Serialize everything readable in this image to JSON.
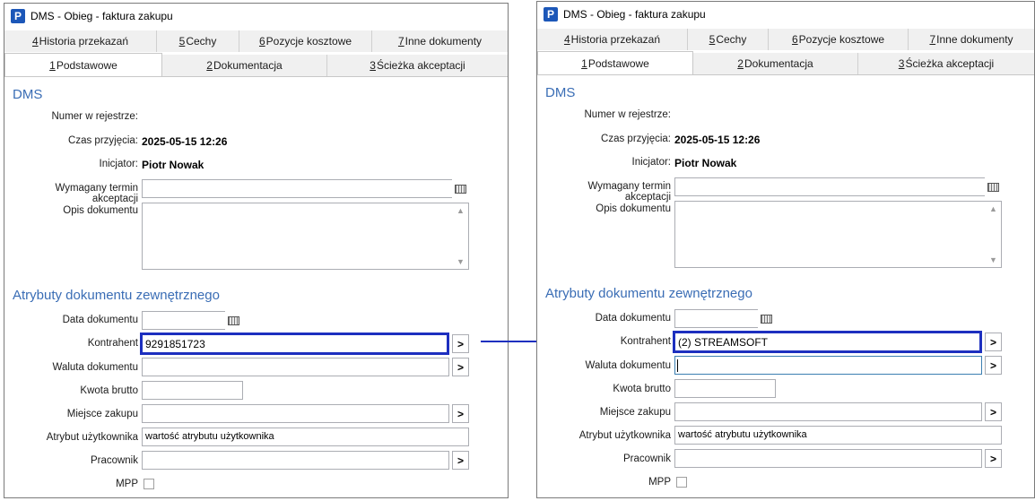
{
  "windows": [
    {
      "title": "DMS - Obieg - faktura zakupu",
      "tabs_row1": [
        {
          "num": "4",
          "label": "Historia przekazań"
        },
        {
          "num": "5",
          "label": "Cechy"
        },
        {
          "num": "6",
          "label": "Pozycje kosztowe"
        },
        {
          "num": "7",
          "label": "Inne dokumenty"
        }
      ],
      "tabs_row2": [
        {
          "num": "1",
          "label": "Podstawowe"
        },
        {
          "num": "2",
          "label": "Dokumentacja"
        },
        {
          "num": "3",
          "label": "Ścieżka akceptacji"
        }
      ],
      "section_dms": "DMS",
      "numer_label": "Numer w rejestrze:",
      "czas_label": "Czas przyjęcia:",
      "czas_value": "2025-05-15 12:26",
      "inicjator_label": "Inicjator:",
      "inicjator_value": "Piotr Nowak",
      "termin_label": "Wymagany termin akceptacji",
      "opis_label": "Opis dokumentu",
      "section_attr": "Atrybuty dokumentu zewnętrznego",
      "data_label": "Data dokumentu",
      "kontrahent_label": "Kontrahent",
      "kontrahent_value": "9291851723",
      "waluta_label": "Waluta dokumentu",
      "kwota_label": "Kwota brutto",
      "miejsce_label": "Miejsce zakupu",
      "atrybut_label": "Atrybut użytkownika",
      "atrybut_value": "wartość atrybutu użytkownika",
      "pracownik_label": "Pracownik",
      "mpp_label": "MPP",
      "arrow_btn": ">"
    },
    {
      "title": "DMS - Obieg - faktura zakupu",
      "tabs_row1": [
        {
          "num": "4",
          "label": "Historia przekazań"
        },
        {
          "num": "5",
          "label": "Cechy"
        },
        {
          "num": "6",
          "label": "Pozycje kosztowe"
        },
        {
          "num": "7",
          "label": "Inne dokumenty"
        }
      ],
      "tabs_row2": [
        {
          "num": "1",
          "label": "Podstawowe"
        },
        {
          "num": "2",
          "label": "Dokumentacja"
        },
        {
          "num": "3",
          "label": "Ścieżka akceptacji"
        }
      ],
      "section_dms": "DMS",
      "numer_label": "Numer w rejestrze:",
      "czas_label": "Czas przyjęcia:",
      "czas_value": "2025-05-15 12:26",
      "inicjator_label": "Inicjator:",
      "inicjator_value": "Piotr Nowak",
      "termin_label": "Wymagany termin akceptacji",
      "opis_label": "Opis dokumentu",
      "section_attr": "Atrybuty dokumentu zewnętrznego",
      "data_label": "Data dokumentu",
      "kontrahent_label": "Kontrahent",
      "kontrahent_value": "(2) STREAMSOFT",
      "waluta_label": "Waluta dokumentu",
      "kwota_label": "Kwota brutto",
      "miejsce_label": "Miejsce zakupu",
      "atrybut_label": "Atrybut użytkownika",
      "atrybut_value": "wartość atrybutu użytkownika",
      "pracownik_label": "Pracownik",
      "mpp_label": "MPP",
      "arrow_btn": ">"
    }
  ],
  "colors": {
    "highlight": "#1d2fbf",
    "section": "#3a6db5",
    "arrow": "#1d2fbf"
  }
}
